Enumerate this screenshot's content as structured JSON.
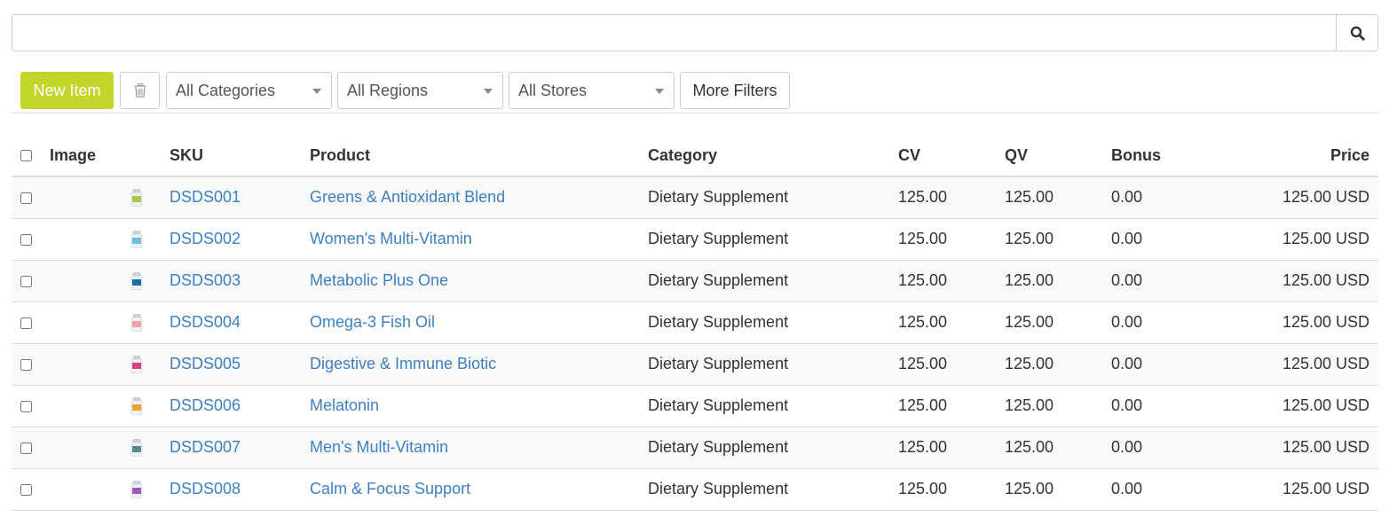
{
  "search": {
    "value": "",
    "placeholder": ""
  },
  "toolbar": {
    "new_item_label": "New Item",
    "categories_label": "All Categories",
    "regions_label": "All Regions",
    "stores_label": "All Stores",
    "more_filters_label": "More Filters"
  },
  "table": {
    "headers": {
      "image": "Image",
      "sku": "SKU",
      "product": "Product",
      "category": "Category",
      "cv": "CV",
      "qv": "QV",
      "bonus": "Bonus",
      "price": "Price"
    },
    "rows": [
      {
        "sku": "DSDS001",
        "product": "Greens & Antioxidant Blend",
        "category": "Dietary Supplement",
        "cv": "125.00",
        "qv": "125.00",
        "bonus": "0.00",
        "price": "125.00 USD",
        "bottle_color": "#a6c94a"
      },
      {
        "sku": "DSDS002",
        "product": "Women's Multi-Vitamin",
        "category": "Dietary Supplement",
        "cv": "125.00",
        "qv": "125.00",
        "bonus": "0.00",
        "price": "125.00 USD",
        "bottle_color": "#6fbfd6"
      },
      {
        "sku": "DSDS003",
        "product": "Metabolic Plus One",
        "category": "Dietary Supplement",
        "cv": "125.00",
        "qv": "125.00",
        "bonus": "0.00",
        "price": "125.00 USD",
        "bottle_color": "#1f6fa8"
      },
      {
        "sku": "DSDS004",
        "product": "Omega-3 Fish Oil",
        "category": "Dietary Supplement",
        "cv": "125.00",
        "qv": "125.00",
        "bonus": "0.00",
        "price": "125.00 USD",
        "bottle_color": "#f0a0a8"
      },
      {
        "sku": "DSDS005",
        "product": "Digestive & Immune Biotic",
        "category": "Dietary Supplement",
        "cv": "125.00",
        "qv": "125.00",
        "bonus": "0.00",
        "price": "125.00 USD",
        "bottle_color": "#d6408a"
      },
      {
        "sku": "DSDS006",
        "product": "Melatonin",
        "category": "Dietary Supplement",
        "cv": "125.00",
        "qv": "125.00",
        "bonus": "0.00",
        "price": "125.00 USD",
        "bottle_color": "#f0a030"
      },
      {
        "sku": "DSDS007",
        "product": "Men's Multi-Vitamin",
        "category": "Dietary Supplement",
        "cv": "125.00",
        "qv": "125.00",
        "bonus": "0.00",
        "price": "125.00 USD",
        "bottle_color": "#5a8a90"
      },
      {
        "sku": "DSDS008",
        "product": "Calm & Focus Support",
        "category": "Dietary Supplement",
        "cv": "125.00",
        "qv": "125.00",
        "bonus": "0.00",
        "price": "125.00 USD",
        "bottle_color": "#9a58c0"
      }
    ]
  },
  "colors": {
    "accent": "#c2d52a",
    "link": "#3d7fc1",
    "stripe": "#f9f9f9",
    "border": "#dddddd"
  },
  "icons": {
    "search": "search-icon",
    "trash": "trash-icon",
    "dropdown": "chevron-down-icon",
    "product_image": "bottle-icon"
  }
}
